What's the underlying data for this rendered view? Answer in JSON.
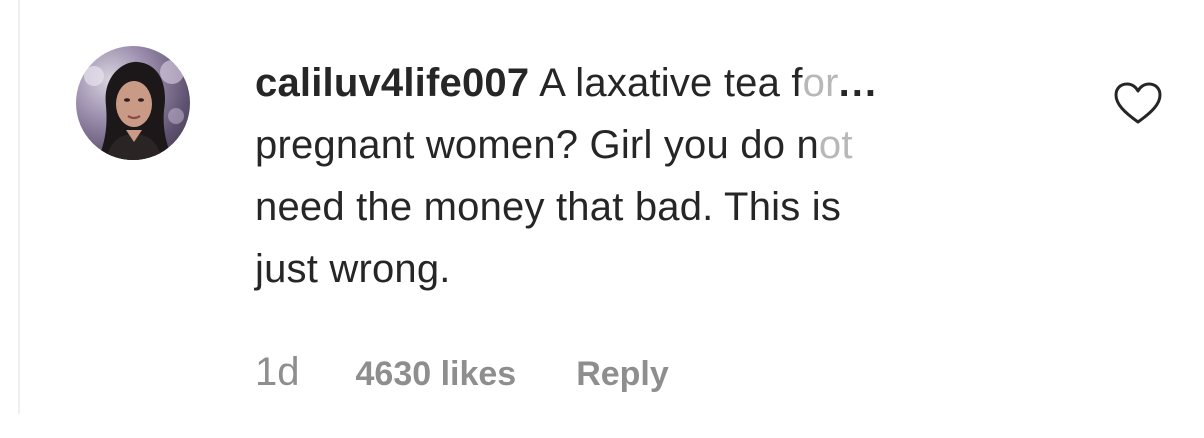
{
  "comment": {
    "username": "caliluv4life007",
    "text_line1": "A laxative tea f",
    "text_line1_fade": "or",
    "ellipsis": "...",
    "text_line2": "pregnant women? Girl you do n",
    "text_line2_fade": "ot",
    "text_line3": "need the money that bad. This is",
    "text_line4": "just wrong.",
    "time": "1d",
    "likes": "4630 likes",
    "reply_label": "Reply",
    "avatar_icon": "profile-photo",
    "like_icon": "heart-outline-icon"
  },
  "colors": {
    "text": "#262626",
    "muted": "#8e8e8e",
    "faded": "#b8b8b8",
    "divider": "#efefef"
  }
}
